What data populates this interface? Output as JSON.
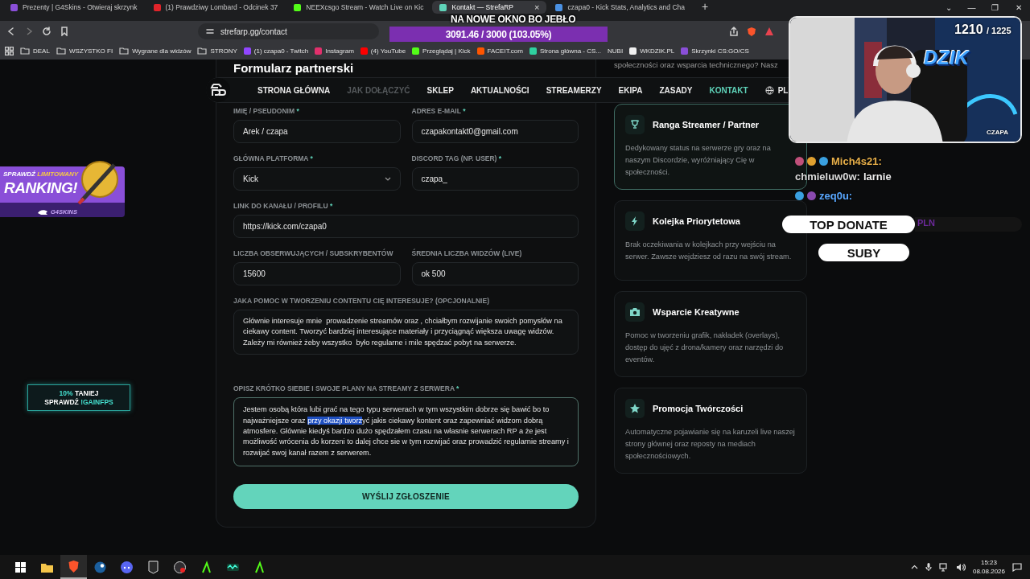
{
  "browser": {
    "tabs": [
      {
        "title": "Prezenty | G4Skins - Otwieraj skrzynk",
        "selected": false,
        "color": "#8a4fd8"
      },
      {
        "title": "(1) Prawdziwy Lombard - Odcinek 37",
        "selected": false,
        "color": "#e0242a"
      },
      {
        "title": "NEEXcsgo Stream - Watch Live on Kic",
        "selected": false,
        "color": "#53fc18"
      },
      {
        "title": "Kontakt — StrefaRP",
        "selected": true,
        "color": "#5fd3b9"
      },
      {
        "title": "czapa0 - Kick Stats, Analytics and Cha",
        "selected": false,
        "color": "#4a90e2"
      }
    ],
    "close_glyph": "×",
    "new_tab_glyph": "+",
    "window_controls": [
      "⌄",
      "—",
      "❐",
      "✕"
    ],
    "address": "strefarp.gg/contact",
    "bookmarks": [
      {
        "label": "DEAL",
        "kind": "folder"
      },
      {
        "label": "WSZYSTKO FI",
        "kind": "folder"
      },
      {
        "label": "Wygrane dla widzów",
        "kind": "folder"
      },
      {
        "label": "STRONY",
        "kind": "folder"
      },
      {
        "label": "(1) czapa0 - Twitch",
        "kind": "site",
        "color": "#9146ff"
      },
      {
        "label": "Instagram",
        "kind": "site",
        "color": "#e1306c"
      },
      {
        "label": "(4) YouTube",
        "kind": "site",
        "color": "#ff0000"
      },
      {
        "label": "Przeglądaj | Kick",
        "kind": "site",
        "color": "#53fc18"
      },
      {
        "label": "FACEIT.com",
        "kind": "site",
        "color": "#ff5500"
      },
      {
        "label": "Strona główna - CS...",
        "kind": "site",
        "color": "#2fd0a0"
      },
      {
        "label": "NUBI",
        "kind": "plain"
      },
      {
        "label": "WKDZIK.PL",
        "kind": "site",
        "color": "#f0f0f0"
      },
      {
        "label": "Skrzynki CS:GO/CS",
        "kind": "site",
        "color": "#8a4fd8"
      }
    ]
  },
  "page": {
    "intro_tail": "społeczności oraz wsparcia technicznego? Nasz",
    "nav": [
      {
        "label": "STRONA GŁÓWNA",
        "selected": false,
        "muted": false,
        "kind": "link"
      },
      {
        "label": "JAK DOŁĄCZYĆ",
        "selected": false,
        "muted": true,
        "kind": "link"
      },
      {
        "label": "SKLEP",
        "selected": false,
        "muted": false,
        "kind": "link"
      },
      {
        "label": "AKTUALNOŚCI",
        "selected": false,
        "muted": false,
        "kind": "link"
      },
      {
        "label": "STREAMERZY",
        "selected": false,
        "muted": false,
        "kind": "link"
      },
      {
        "label": "EKIPA",
        "selected": false,
        "muted": false,
        "kind": "link"
      },
      {
        "label": "ZASADY",
        "selected": false,
        "muted": false,
        "kind": "link"
      },
      {
        "label": "KONTAKT",
        "selected": true,
        "muted": false,
        "kind": "link"
      },
      {
        "label": "PL",
        "selected": false,
        "muted": false,
        "kind": "language"
      }
    ],
    "form": {
      "title": "Formularz partnerski",
      "rows": [
        [
          {
            "label": "IMIĘ / PSEUDONIM",
            "marker": "*",
            "kind": "text",
            "value": "Arek / czapa"
          },
          {
            "label": "ADRES E-MAIL",
            "marker": "*",
            "kind": "text",
            "value": "czapakontakt0@gmail.com"
          }
        ],
        [
          {
            "label": "GŁÓWNA PLATFORMA",
            "marker": "*",
            "kind": "select",
            "value": "Kick"
          },
          {
            "label": "DISCORD TAG (NP. USER)",
            "marker": "*",
            "kind": "text",
            "value": "czapa_"
          }
        ],
        [
          {
            "label": "LINK DO KANAŁU / PROFILU",
            "marker": "*",
            "kind": "text",
            "value": "https://kick.com/czapa0"
          }
        ],
        [
          {
            "label": "LICZBA OBSERWUJĄCYCH / SUBSKRYBENTÓW",
            "kind": "text",
            "value": "15600"
          },
          {
            "label": "ŚREDNIA LICZBA WIDZÓW (LIVE)",
            "kind": "text",
            "value": "ok 500"
          }
        ],
        [
          {
            "label": "JAKA POMOC W TWORZENIU CONTENTU CIĘ INTERESUJE? (OPCJONALNIE)",
            "kind": "textarea",
            "focused": false,
            "value_parts": [
              {
                "text": "Głównie interesuje mnie  prowadzenie streamów oraz , chciałbym rozwijanie swoich pomysłów na ciekawy content. Tworzyć bardziej interesujące materiały i przyciągnąć większa uwagę widzów. Zależy mi również żeby wszystko  było regularne i mile spędzać pobyt na serwerze.",
                "selected": false
              }
            ]
          }
        ],
        [
          {
            "label": "OPISZ KRÓTKO SIEBIE I SWOJE PLANY NA STREAMY Z SERWERA",
            "marker": "*",
            "kind": "textarea",
            "focused": true,
            "value_parts": [
              {
                "text": "Jestem osobą która lubi grać na tego typu serwerach w tym wszystkim dobrze się bawić bo to najważniejsze oraz ",
                "selected": false
              },
              {
                "text": "przy okazji tworz",
                "selected": true
              },
              {
                "text": "yć jakis ciekawy kontent oraz zapewniać widzom dobrą atmosfere. Głównie kiedyś bardzo dużo spędzałem czasu na własnie serwerach RP a że jest możliwość wrócenia do korzeni to dalej chce sie w tym rozwijać oraz prowadzić regularnie streamy i rozwijać swoj kanał razem z serwerem.",
                "selected": false
              }
            ]
          }
        ]
      ],
      "submit": "WYŚLIJ ZGŁOSZENIE"
    },
    "perks": [
      {
        "kind": "trophy",
        "title": "Ranga Streamer / Partner",
        "description": "Dedykowany status na serwerze gry oraz na naszym Discordzie, wyróżniający Cię w społeczności.",
        "highlighted": true
      },
      {
        "kind": "bolt",
        "title": "Kolejka Priorytetowa",
        "description": "Brak oczekiwania w kolejkach przy wejściu na serwer. Zawsze wejdziesz od razu na swój stream.",
        "highlighted": false
      },
      {
        "kind": "camera",
        "title": "Wsparcie Kreatywne",
        "description": "Pomoc w tworzeniu grafik, nakładek (overlays), dostęp do ujęć z drona/kamery oraz narzędzi do eventów.",
        "highlighted": false
      },
      {
        "kind": "star",
        "title": "Promocja Twórczości",
        "description": "Automatyczne pojawianie się na karuzeli live naszej strony głównej oraz reposty na mediach społecznościowych.",
        "highlighted": false
      }
    ]
  },
  "overlay": {
    "headline": "NA NOWE OKNO BO JEBŁO",
    "goal": {
      "reading": "3091.46 / 3000 (103.05%)",
      "level": 1
    },
    "webcam": {
      "kind": "picture",
      "count": "1210",
      "total": "/ 1225",
      "logo": "DZIK",
      "label": "CZAPA"
    },
    "chat": [
      {
        "user": "Mich4s21:",
        "color": "#e8b04a",
        "badges": [
          {
            "color": "#c0507a"
          },
          {
            "color": "#e0a030"
          },
          {
            "color": "#3aa0e0"
          }
        ]
      },
      {
        "user": "chmieluw0w:",
        "message": "larnie",
        "color": "#dcdcdc"
      },
      {
        "user": "zeq0u:",
        "color": "#5aa8ff",
        "badges": [
          {
            "color": "#3aa0e0"
          },
          {
            "color": "#8a4ab0"
          }
        ]
      }
    ],
    "top_donate": {
      "label": "TOP DONATE",
      "currency": "PLN"
    },
    "subs": {
      "label": "SUBY"
    },
    "ranking_ad": {
      "lead": "SPRAWDŹ",
      "highlight": "LIMITOWANY",
      "headline": "RANKING!",
      "brand": "G4SKINS"
    },
    "promo_ad": {
      "lines": [
        [
          {
            "text": "10%",
            "accent": true
          },
          {
            "text": " TANIEJ",
            "accent": false
          }
        ],
        [
          {
            "text": "SPRAWDŹ ",
            "accent": false
          },
          {
            "text": "!GAINFPS",
            "accent": true
          }
        ]
      ]
    }
  },
  "taskbar": {
    "apps": [
      {
        "kind": "start",
        "active": false
      },
      {
        "kind": "explorer",
        "active": false
      },
      {
        "kind": "brave",
        "active": true
      },
      {
        "kind": "steam",
        "active": false
      },
      {
        "kind": "discord",
        "active": false
      },
      {
        "kind": "epic",
        "active": false
      },
      {
        "kind": "obs",
        "active": false
      },
      {
        "kind": "kick",
        "active": false
      },
      {
        "kind": "wave",
        "active": false
      },
      {
        "kind": "kick",
        "active": false
      }
    ],
    "time": "15:23",
    "date": "08.08.2026"
  }
}
